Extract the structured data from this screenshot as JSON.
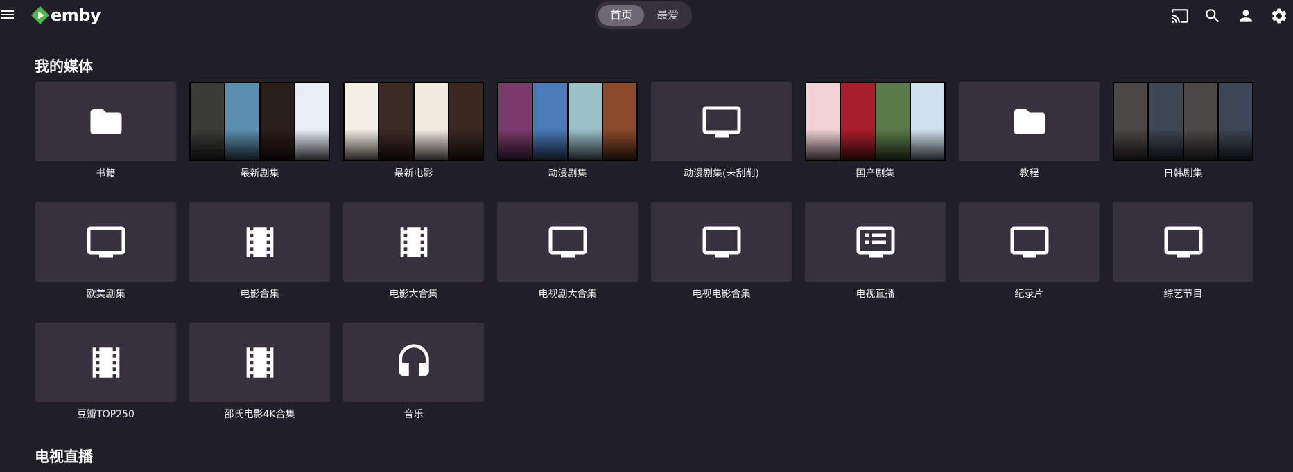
{
  "header": {
    "logo_text": "emby",
    "tabs": [
      {
        "label": "首页",
        "active": true
      },
      {
        "label": "最爱",
        "active": false
      }
    ],
    "icons": [
      "menu-icon",
      "cast-icon",
      "search-icon",
      "user-icon",
      "settings-icon"
    ]
  },
  "sections": {
    "my_media_title": "我的媒体",
    "live_tv_title": "电视直播"
  },
  "media": [
    {
      "label": "书籍",
      "icon": "folder-icon"
    },
    {
      "label": "最新剧集",
      "icon": "poster-collage",
      "posters": [
        "#3a3a36",
        "#5a8fb0",
        "#2a1e1a",
        "#e8eef4"
      ]
    },
    {
      "label": "最新电影",
      "icon": "poster-collage",
      "posters": [
        "#f4efe4",
        "#3b2a24",
        "#f2ece0",
        "#3a2820"
      ]
    },
    {
      "label": "动漫剧集",
      "icon": "poster-collage",
      "posters": [
        "#7a3a6a",
        "#4a7ab8",
        "#9ac0c8",
        "#8a4a2a"
      ]
    },
    {
      "label": "动漫剧集(未刮削)",
      "icon": "tv-icon"
    },
    {
      "label": "国产剧集",
      "icon": "poster-collage",
      "posters": [
        "#f0d2d6",
        "#a81e2a",
        "#5a7a4a",
        "#cfe0ee"
      ]
    },
    {
      "label": "教程",
      "icon": "folder-icon"
    },
    {
      "label": "日韩剧集",
      "icon": "poster-collage",
      "posters": [
        "#4a4844",
        "#3c4654",
        "#4a4844",
        "#3c4654"
      ]
    },
    {
      "label": "欧美剧集",
      "icon": "tv-icon"
    },
    {
      "label": "电影合集",
      "icon": "film-icon"
    },
    {
      "label": "电影大合集",
      "icon": "film-icon"
    },
    {
      "label": "电视剧大合集",
      "icon": "tv-icon"
    },
    {
      "label": "电视电影合集",
      "icon": "tv-icon"
    },
    {
      "label": "电视直播",
      "icon": "live-tv-icon"
    },
    {
      "label": "纪录片",
      "icon": "tv-icon"
    },
    {
      "label": "综艺节目",
      "icon": "tv-icon"
    },
    {
      "label": "豆瓣TOP250",
      "icon": "film-icon"
    },
    {
      "label": "邵氏电影4K合集",
      "icon": "film-icon"
    },
    {
      "label": "音乐",
      "icon": "headphones-icon"
    }
  ],
  "colors": {
    "background": "#201e27",
    "card": "#35323e",
    "accent_green": "#52b54b",
    "tab_active": "#6c6974"
  }
}
